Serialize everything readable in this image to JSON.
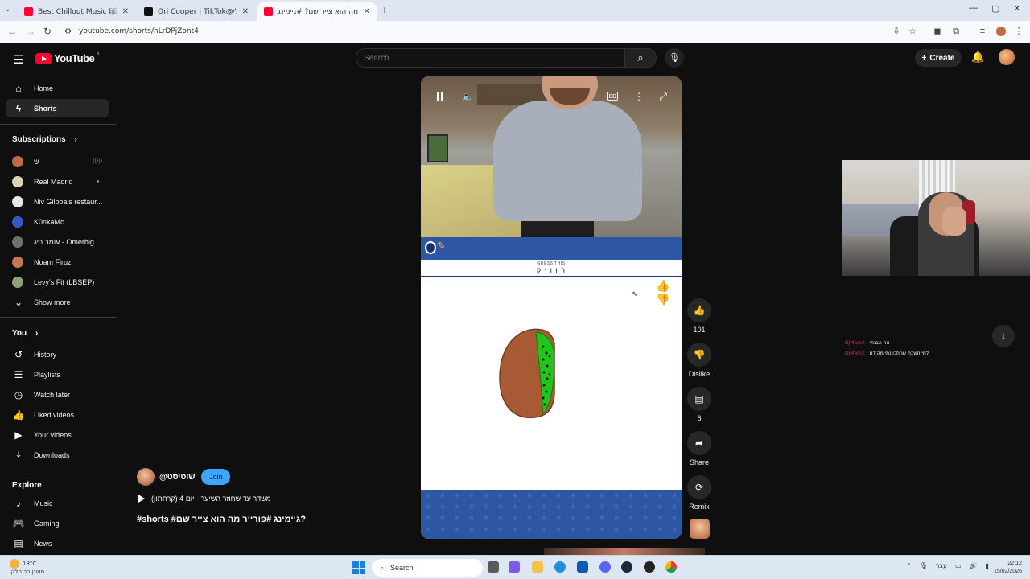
{
  "browser": {
    "tabs": [
      {
        "title": "Best Chillout Music 🎼 LOUNGE",
        "favicon_color": "#ff0033",
        "active": false
      },
      {
        "title": "Ori Cooper | TikTok@ניצה אולי",
        "favicon_color": "#111111",
        "active": false
      },
      {
        "title": "מה הוא צייר שם? #גיימינג #",
        "favicon_color": "#ff0033",
        "active": true
      }
    ],
    "url": "youtube.com/shorts/hLrDPjZont4"
  },
  "header": {
    "logo_text": "YouTube",
    "country_code": "IL",
    "search_placeholder": "Search",
    "create_label": "Create"
  },
  "sidebar": {
    "main": [
      {
        "label": "Home",
        "icon": "home-icon",
        "glyph": "⌂"
      },
      {
        "label": "Shorts",
        "icon": "shorts-icon",
        "glyph": "ϟ",
        "active": true
      }
    ],
    "subscriptions_title": "Subscriptions",
    "subscriptions": [
      {
        "label": "ש",
        "color": "#c26a45",
        "indicator": "live"
      },
      {
        "label": "Real Madrid",
        "color": "#d8d2b8",
        "indicator": "dot"
      },
      {
        "label": "Niv Gilboa's restaur...",
        "color": "#e6e6e6",
        "indicator": ""
      },
      {
        "label": "K0nkaMc",
        "color": "#3b57c4",
        "indicator": ""
      },
      {
        "label": "עומר ביג - Omerbig",
        "color": "#6f6f6f",
        "indicator": ""
      },
      {
        "label": "Noam Firuz",
        "color": "#c27a55",
        "indicator": ""
      },
      {
        "label": "Levy's Fit (LBSEP)",
        "color": "#8aa37a",
        "indicator": ""
      }
    ],
    "show_more": "Show more",
    "you_title": "You",
    "you_items": [
      {
        "label": "History",
        "glyph": "↺",
        "icon": "history-icon"
      },
      {
        "label": "Playlists",
        "glyph": "☰",
        "icon": "playlists-icon"
      },
      {
        "label": "Watch later",
        "glyph": "◷",
        "icon": "watch-later-icon"
      },
      {
        "label": "Liked videos",
        "glyph": "👍",
        "icon": "thumbs-up-icon"
      },
      {
        "label": "Your videos",
        "glyph": "▶",
        "icon": "your-videos-icon"
      },
      {
        "label": "Downloads",
        "glyph": "⤓",
        "icon": "download-icon"
      }
    ],
    "explore_title": "Explore",
    "explore_items": [
      {
        "label": "Music",
        "glyph": "♪",
        "icon": "music-icon"
      },
      {
        "label": "Gaming",
        "glyph": "🎮",
        "icon": "gaming-icon"
      },
      {
        "label": "News",
        "glyph": "▤",
        "icon": "news-icon"
      }
    ]
  },
  "short": {
    "guess_label": "GUESS THIS",
    "guess_word": "ר ו ו י ק",
    "channel_handle": "@שוטיסט",
    "join_label": "Join",
    "playlist_title": "משדר עד שחוזר השיער - יום 4 (קרחתון)",
    "title": "מה הוא צייר שם? #גיימינג #פורטנייט #shorts",
    "title_display": "#shorts #גיימינג #פורייר מה הוא צייר שם?",
    "drawing": {
      "shape": "kiwi-slice",
      "skin_color": "#a85a35",
      "flesh_color": "#22c51e"
    }
  },
  "actions": {
    "likes": "101",
    "dislike_label": "Dislike",
    "comments": "6",
    "share_label": "Share",
    "remix_label": "Remix"
  },
  "chat": [
    {
      "user": "DjMam2 :",
      "message": "אה הבנתי"
    },
    {
      "user": "DjMam2 :",
      "message": "למי חשבת שהתכוונתי מקודם"
    }
  ],
  "taskbar": {
    "temperature": "18°C",
    "weather_desc": "מעונן רב חלקי",
    "search_label": "Search",
    "language": "עבר",
    "time": "22:12",
    "date": "15/02/2026"
  }
}
